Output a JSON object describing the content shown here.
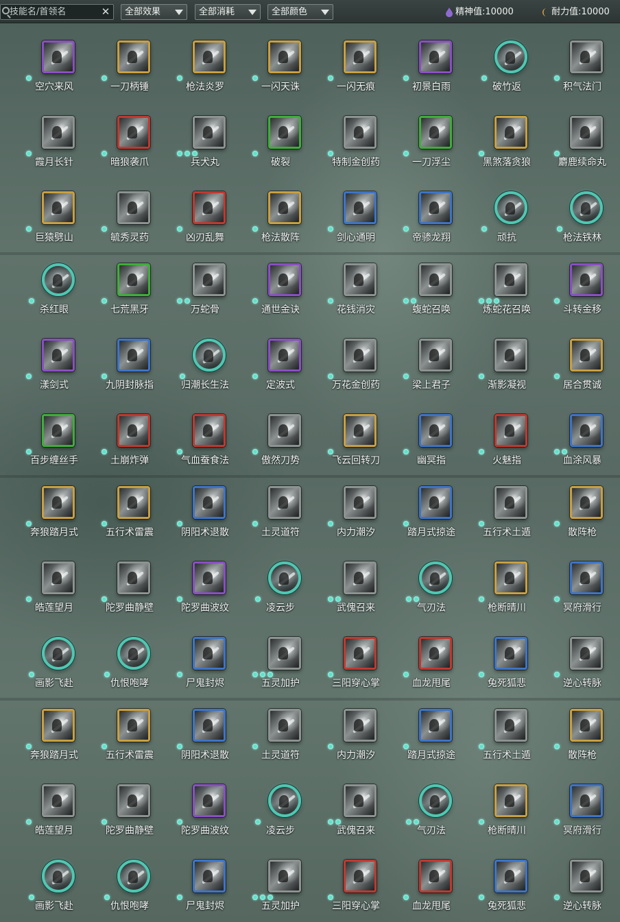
{
  "toolbar": {
    "search_placeholder": "技能名/首领名",
    "clear_glyph": "✕",
    "filters": [
      {
        "label": "全部效果",
        "name": "effect-filter-dropdown"
      },
      {
        "label": "全部消耗",
        "name": "cost-filter-dropdown"
      },
      {
        "label": "全部颜色",
        "name": "color-filter-dropdown"
      }
    ],
    "spirit": {
      "label": "精神值:10000",
      "color": "#8e6ad0",
      "icon": "spirit-drop-icon"
    },
    "stamina": {
      "label": "耐力值:10000",
      "color": "#d8a24a",
      "icon": "stamina-moon-icon"
    }
  },
  "colors": {
    "gold": "#c9a040",
    "purple": "#8a4fc4",
    "green": "#3fae3a",
    "red": "#c0392f",
    "blue": "#3d74c8",
    "gray": "#8c9390",
    "teal": "#4fc7b2",
    "dot": "#5fe0c9"
  },
  "skills": [
    {
      "name": "空穴来风",
      "frame": "purple",
      "dots": 1
    },
    {
      "name": "一刀柄锤",
      "frame": "gold",
      "dots": 1
    },
    {
      "name": "枪法炎罗",
      "frame": "gold",
      "dots": 1
    },
    {
      "name": "一闪天诛",
      "frame": "gold",
      "dots": 1
    },
    {
      "name": "一闪无痕",
      "frame": "gold",
      "dots": 1
    },
    {
      "name": "初景白雨",
      "frame": "purple",
      "dots": 1
    },
    {
      "name": "破竹返",
      "frame": "circle",
      "dots": 1
    },
    {
      "name": "积气法门",
      "frame": "gray",
      "dots": 1
    },
    {
      "name": "霞月长针",
      "frame": "gray",
      "dots": 1
    },
    {
      "name": "暗狼袭爪",
      "frame": "red",
      "dots": 1
    },
    {
      "name": "兵犬丸",
      "frame": "gray",
      "dots": 3
    },
    {
      "name": "破裂",
      "frame": "green",
      "dots": 1
    },
    {
      "name": "特制金创药",
      "frame": "gray",
      "dots": 1
    },
    {
      "name": "一刀浮尘",
      "frame": "green",
      "dots": 1
    },
    {
      "name": "黑煞落贪狼",
      "frame": "gold",
      "dots": 1
    },
    {
      "name": "麝鹿续命丸",
      "frame": "gray",
      "dots": 1
    },
    {
      "name": "巨猿劈山",
      "frame": "gold",
      "dots": 1
    },
    {
      "name": "毓秀灵药",
      "frame": "gray",
      "dots": 1
    },
    {
      "name": "凶刃乱舞",
      "frame": "red",
      "dots": 1
    },
    {
      "name": "枪法散阵",
      "frame": "gold",
      "dots": 1
    },
    {
      "name": "剑心通明",
      "frame": "blue",
      "dots": 1
    },
    {
      "name": "帝骖龙翔",
      "frame": "blue",
      "dots": 1
    },
    {
      "name": "顽抗",
      "frame": "circle",
      "dots": 1
    },
    {
      "name": "枪法铁林",
      "frame": "circle",
      "dots": 1
    },
    {
      "name": "杀红眼",
      "frame": "circle",
      "dots": 1
    },
    {
      "name": "七荒黑牙",
      "frame": "green",
      "dots": 1
    },
    {
      "name": "万蛇骨",
      "frame": "gray",
      "dots": 2
    },
    {
      "name": "通世金诀",
      "frame": "purple",
      "dots": 1
    },
    {
      "name": "花钱消灾",
      "frame": "gray",
      "dots": 1
    },
    {
      "name": "蝮蛇召唤",
      "frame": "gray",
      "dots": 2
    },
    {
      "name": "炼蛇花召唤",
      "frame": "gray",
      "dots": 3
    },
    {
      "name": "斗转金移",
      "frame": "purple",
      "dots": 1
    },
    {
      "name": "漾剑式",
      "frame": "purple",
      "dots": 1
    },
    {
      "name": "九阴封脉指",
      "frame": "blue",
      "dots": 1
    },
    {
      "name": "归潮长生法",
      "frame": "circle",
      "dots": 1
    },
    {
      "name": "定波式",
      "frame": "purple",
      "dots": 1
    },
    {
      "name": "万花金创药",
      "frame": "gray",
      "dots": 1
    },
    {
      "name": "梁上君子",
      "frame": "gray",
      "dots": 1
    },
    {
      "name": "渐影凝视",
      "frame": "gray",
      "dots": 1
    },
    {
      "name": "居合贯诚",
      "frame": "gold",
      "dots": 1
    },
    {
      "name": "百步缠丝手",
      "frame": "green",
      "dots": 1
    },
    {
      "name": "土崩炸弹",
      "frame": "red",
      "dots": 1
    },
    {
      "name": "气血蚕食法",
      "frame": "red",
      "dots": 1
    },
    {
      "name": "傲然刀势",
      "frame": "gray",
      "dots": 1
    },
    {
      "name": "飞云回转刀",
      "frame": "gold",
      "dots": 1
    },
    {
      "name": "幽冥指",
      "frame": "blue",
      "dots": 1
    },
    {
      "name": "火魅指",
      "frame": "red",
      "dots": 1
    },
    {
      "name": "血涂风暴",
      "frame": "blue",
      "dots": 2
    },
    {
      "name": "奔狼踏月式",
      "frame": "gold",
      "dots": 1
    },
    {
      "name": "五行术雷震",
      "frame": "gold",
      "dots": 1
    },
    {
      "name": "阴阳术退散",
      "frame": "blue",
      "dots": 1
    },
    {
      "name": "土灵道符",
      "frame": "gray",
      "dots": 1
    },
    {
      "name": "内力潮汐",
      "frame": "gray",
      "dots": 1
    },
    {
      "name": "踏月式掠途",
      "frame": "blue",
      "dots": 1
    },
    {
      "name": "五行术土遁",
      "frame": "gray",
      "dots": 1
    },
    {
      "name": "散阵枪",
      "frame": "gold",
      "dots": 1
    },
    {
      "name": "皓莲望月",
      "frame": "gray",
      "dots": 1
    },
    {
      "name": "陀罗曲静壁",
      "frame": "gray",
      "dots": 1
    },
    {
      "name": "陀罗曲波纹",
      "frame": "purple",
      "dots": 1
    },
    {
      "name": "凌云步",
      "frame": "circle",
      "dots": 1
    },
    {
      "name": "武傀召来",
      "frame": "gray",
      "dots": 2
    },
    {
      "name": "气刃法",
      "frame": "circle",
      "dots": 2
    },
    {
      "name": "枪断晴川",
      "frame": "gold",
      "dots": 1
    },
    {
      "name": "冥府滑行",
      "frame": "blue",
      "dots": 1
    },
    {
      "name": "画影飞赴",
      "frame": "circle",
      "dots": 1
    },
    {
      "name": "仇恨咆哮",
      "frame": "circle",
      "dots": 1
    },
    {
      "name": "尸鬼封烬",
      "frame": "blue",
      "dots": 1
    },
    {
      "name": "五灵加护",
      "frame": "gray",
      "dots": 3
    },
    {
      "name": "三阳穿心掌",
      "frame": "red",
      "dots": 1
    },
    {
      "name": "血龙甩尾",
      "frame": "red",
      "dots": 1
    },
    {
      "name": "兔死狐悲",
      "frame": "blue",
      "dots": 1
    },
    {
      "name": "逆心转脉",
      "frame": "gray",
      "dots": 1
    },
    {
      "name": "奔狼踏月式",
      "frame": "gold",
      "dots": 1
    },
    {
      "name": "五行术雷震",
      "frame": "gold",
      "dots": 1
    },
    {
      "name": "阴阳术退散",
      "frame": "blue",
      "dots": 1
    },
    {
      "name": "土灵道符",
      "frame": "gray",
      "dots": 1
    },
    {
      "name": "内力潮汐",
      "frame": "gray",
      "dots": 1
    },
    {
      "name": "踏月式掠途",
      "frame": "blue",
      "dots": 1
    },
    {
      "name": "五行术土遁",
      "frame": "gray",
      "dots": 1
    },
    {
      "name": "散阵枪",
      "frame": "gold",
      "dots": 1
    },
    {
      "name": "皓莲望月",
      "frame": "gray",
      "dots": 1
    },
    {
      "name": "陀罗曲静壁",
      "frame": "gray",
      "dots": 1
    },
    {
      "name": "陀罗曲波纹",
      "frame": "purple",
      "dots": 1
    },
    {
      "name": "凌云步",
      "frame": "circle",
      "dots": 1
    },
    {
      "name": "武傀召来",
      "frame": "gray",
      "dots": 2
    },
    {
      "name": "气刃法",
      "frame": "circle",
      "dots": 2
    },
    {
      "name": "枪断晴川",
      "frame": "gold",
      "dots": 1
    },
    {
      "name": "冥府滑行",
      "frame": "blue",
      "dots": 1
    },
    {
      "name": "画影飞赴",
      "frame": "circle",
      "dots": 1
    },
    {
      "name": "仇恨咆哮",
      "frame": "circle",
      "dots": 1
    },
    {
      "name": "尸鬼封烬",
      "frame": "blue",
      "dots": 1
    },
    {
      "name": "五灵加护",
      "frame": "gray",
      "dots": 3
    },
    {
      "name": "三阳穿心掌",
      "frame": "red",
      "dots": 1
    },
    {
      "name": "血龙甩尾",
      "frame": "red",
      "dots": 1
    },
    {
      "name": "兔死狐悲",
      "frame": "blue",
      "dots": 1
    },
    {
      "name": "逆心转脉",
      "frame": "gray",
      "dots": 1
    }
  ]
}
